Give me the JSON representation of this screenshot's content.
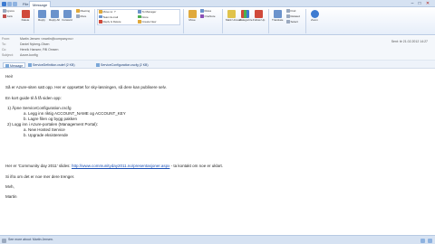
{
  "tabs": [
    "File",
    "Message"
  ],
  "window": {
    "title": "",
    "min": "–",
    "max": "□",
    "close": "✕"
  },
  "ribbon": {
    "groups": [
      {
        "name": "Delete",
        "buttons": [
          "Ignore",
          "Junk",
          "Delete"
        ]
      },
      {
        "name": "Respond",
        "buttons": [
          "Reply",
          "Reply All",
          "Forward",
          "Meeting",
          "More"
        ]
      },
      {
        "name": "Quick Steps",
        "buttons": [
          "Move to: ?",
          "Team E-mail",
          "Reply & Delete",
          "To Manager",
          "Done",
          "Create New"
        ]
      },
      {
        "name": "Move",
        "buttons": [
          "Move",
          "Rules",
          "OneNote"
        ]
      },
      {
        "name": "Tags",
        "buttons": [
          "Mark Unread",
          "Categorize",
          "Follow Up"
        ]
      },
      {
        "name": "Editing",
        "buttons": [
          "Translate",
          "Find",
          "Related",
          "Select"
        ]
      },
      {
        "name": "Zoom",
        "buttons": [
          "Zoom"
        ]
      }
    ]
  },
  "header": {
    "from_label": "From:",
    "from": "Martin Jensen <martin@company.no>",
    "to_label": "To:",
    "to": "Daniel Nyberg-Olsen",
    "cc_label": "Cc:",
    "cc": "Henrik Hansen; Pål Omsen",
    "subject_label": "Subject:",
    "subject": "Azure-konfig",
    "sent": "Sent: tir 21.02.2012 14:27"
  },
  "attachments": [
    {
      "name": "Message",
      "selected": true
    },
    {
      "name": "ServiceDefinition.csdef (2 KB)",
      "selected": false
    },
    {
      "name": "ServiceConfiguration.cscfg (2 KB)",
      "selected": false
    }
  ],
  "body": {
    "greeting": "Hei!",
    "para1": "Så er Azure-siten satt opp. Her er oppsettet for sky-løsningen, så dere kan publisere selv.",
    "para2": "En kort guide til å få siden opp:",
    "item1": "1)   Åpne ServiceConfiguration.cscfg",
    "item1a": "a.   Legg inn riktig ACCOUNT_NAME og ACCOUNT_KEY",
    "item1b": "b.   Lagre filen og bygg pakken",
    "item2": "2)   Logg inn i Azure-portalen (Management Portal):",
    "item2a": "a.   New Hosted Service",
    "item2b": "b.   Upgrade eksisterende",
    "para3_pre": "Her er 'Community day 2011' slides:",
    "para3_link": "http://www.communityday2011.no/presentasjoner.aspx",
    "para3_post": " - ta kontakt om noe er uklart.",
    "para4": "Si ifra om det er noe mer dere trenger.",
    "signoff": "Mvh,",
    "name": "Martin"
  },
  "status": {
    "text": "See more about: Martin Jensen."
  },
  "colors": {
    "accent": "#1a4fb5",
    "ribbon_bg": "#e6eef9",
    "titlebar": "#d6e2f2"
  }
}
